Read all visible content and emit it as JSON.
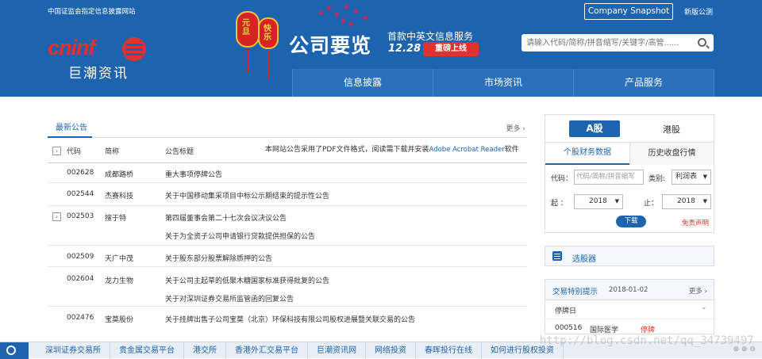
{
  "header": {
    "top_text": "中国证监会指定信息披露网站",
    "snapshot_button": "Company Snapshot",
    "weibo": "新版公测",
    "logo_en": "cninf",
    "logo_cn": "巨潮资讯",
    "lantern_text_1": "元旦",
    "lantern_text_2": "快乐",
    "banner_title": "公司要览",
    "banner_tagline": "首款中英文信息服务",
    "banner_date": "12.28",
    "banner_badge": "重磅上线",
    "search_placeholder": "请输入代码/简称/拼音缩写/关键字/高管......",
    "nav": [
      "信息披露",
      "市场资讯",
      "产品服务"
    ]
  },
  "announcements": {
    "tab": "最新公告",
    "more": "更多 ›",
    "columns": {
      "code": "代码",
      "name": "简称",
      "title": "公告标题"
    },
    "note_prefix": "本网站公告采用了PDF文件格式，阅读需下载并安装",
    "note_link": "Adobe Acrobat Reader",
    "note_suffix": "软件",
    "rows": [
      {
        "code": "002628",
        "name": "成都路桥",
        "titles": [
          "重大事项停牌公告"
        ]
      },
      {
        "code": "002544",
        "name": "杰赛科技",
        "titles": [
          "关于中国移动集采项目中标公示期结束的提示性公告"
        ]
      },
      {
        "code": "002503",
        "name": "搜于特",
        "titles": [
          "第四届董事会第二十七次会议决议公告",
          "关于为全资子公司申请银行贷款提供担保的公告"
        ]
      },
      {
        "code": "002509",
        "name": "天广中茂",
        "titles": [
          "关于股东部分股票解除质押的公告"
        ]
      },
      {
        "code": "002604",
        "name": "龙力生物",
        "titles": [
          "关于公司主起草的低聚木糖国家标准获得批复的公告",
          "关于对深圳证券交易所监管函的回复公告"
        ]
      },
      {
        "code": "002476",
        "name": "宝莫股份",
        "titles": [
          "关于挂牌出售子公司宝莫（北京）环保科技有限公司股权进展暨关联交易的公告"
        ]
      }
    ]
  },
  "finance": {
    "tab_a": "A股",
    "tab_hk": "港股",
    "sub_tab_1": "个股财务数据",
    "sub_tab_2": "历史收盘行情",
    "code_label": "代码：",
    "code_placeholder": "代码/简称/拼音缩写",
    "type_label": "类别:",
    "type_value": "利润表",
    "from_label": "起 ：",
    "from_value": "2018",
    "to_label": "止：",
    "to_value": "2018",
    "download": "下载",
    "disclaimer": "免责声明"
  },
  "screener": {
    "label": "选股器"
  },
  "trading": {
    "title": "交易特别提示",
    "date": "2018-01-02",
    "more": "更多 ›",
    "suspend_label": "停牌日",
    "chevron": "⌄",
    "rows": [
      {
        "code": "000516",
        "name": "国际医学",
        "status": "停牌"
      }
    ]
  },
  "footer": {
    "links": [
      "深圳证券交易所",
      "贵金属交易平台",
      "港交所",
      "香港外汇交易平台",
      "巨潮资讯网",
      "网络投资",
      "春晖投行在线",
      "如何进行股权投资"
    ],
    "controls": "⊗ ⊕ ⊖"
  },
  "watermark": "http://blog.csdn.net/qq_34739497",
  "colors": {
    "brand_blue": "#1e63ae",
    "brand_red": "#e4312b"
  }
}
